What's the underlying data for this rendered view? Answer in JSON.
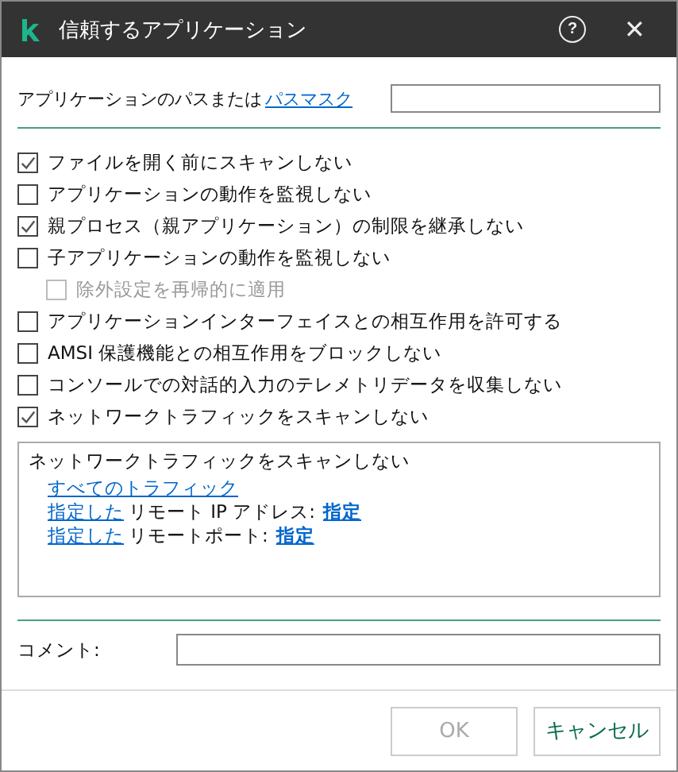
{
  "window": {
    "title": "信頼するアプリケーション",
    "help": "?",
    "close": "✕"
  },
  "path": {
    "label": "アプリケーションのパスまたは",
    "link": "パスマスク"
  },
  "options": [
    {
      "label": "ファイルを開く前にスキャンしない",
      "checked": true,
      "disabled": false
    },
    {
      "label": "アプリケーションの動作を監視しない",
      "checked": false,
      "disabled": false
    },
    {
      "label": "親プロセス（親アプリケーション）の制限を継承しない",
      "checked": true,
      "disabled": false
    },
    {
      "label": "子アプリケーションの動作を監視しない",
      "checked": false,
      "disabled": false,
      "children": [
        {
          "label": "除外設定を再帰的に適用",
          "checked": false,
          "disabled": true
        }
      ]
    },
    {
      "label": "アプリケーションインターフェイスとの相互作用を許可する",
      "checked": false,
      "disabled": false
    },
    {
      "label": "AMSI 保護機能との相互作用をブロックしない",
      "checked": false,
      "disabled": false
    },
    {
      "label": "コンソールでの対話的入力のテレメトリデータを収集しない",
      "checked": false,
      "disabled": false
    },
    {
      "label": "ネットワークトラフィックをスキャンしない",
      "checked": true,
      "disabled": false
    }
  ],
  "details": {
    "heading": "ネットワークトラフィックをスキャンしない",
    "lines": [
      [
        {
          "kind": "link",
          "text": "すべてのトラフィック"
        }
      ],
      [
        {
          "kind": "link",
          "text": "指定した"
        },
        {
          "kind": "text",
          "text": "リモート IP アドレス:"
        },
        {
          "kind": "strong-link",
          "text": "指定"
        }
      ],
      [
        {
          "kind": "link",
          "text": "指定した"
        },
        {
          "kind": "text",
          "text": "リモートポート:"
        },
        {
          "kind": "strong-link",
          "text": "指定"
        }
      ]
    ]
  },
  "comment": {
    "label": "コメント:"
  },
  "buttons": [
    {
      "label": "OK",
      "disabled": true
    },
    {
      "label": "キャンセル",
      "disabled": false
    }
  ]
}
